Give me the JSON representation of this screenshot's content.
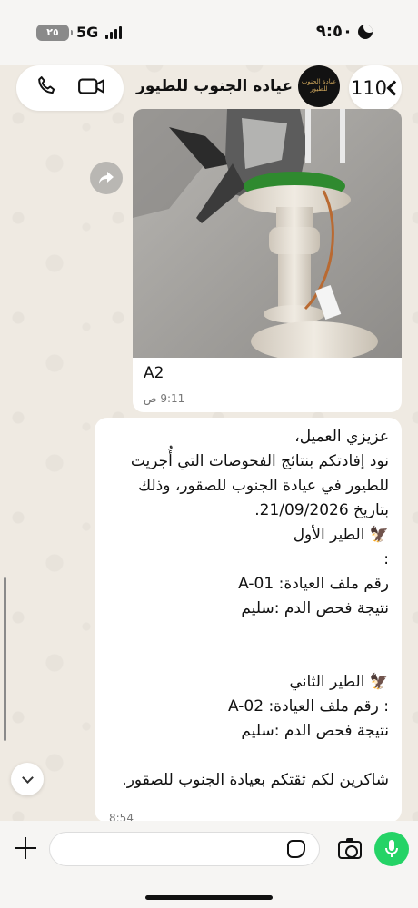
{
  "status_bar": {
    "time": "٩:٥٠",
    "battery": "٢٥",
    "network": "5G"
  },
  "header": {
    "back_count": "110",
    "chat_title": "عياده الجنوب للطيور",
    "avatar_text": "عيادة الجنوب للطيور"
  },
  "image_message": {
    "caption": "A2",
    "time": "9:11 ص"
  },
  "text_message": {
    "body": "عزيزي العميل،\nنود إفادتكم بنتائج الفحوصات التي أُجريت للطيور في عيادة الجنوب للصقور، وذلك بتاريخ 21/09/2026.\n🦅 الطير الأول\n:\nرقم ملف العيادة: A-01\nنتيجة فحص الدم :سليم\n\n\n🦅 الطير الثاني\n: رقم ملف العيادة: A-02\nنتيجة فحص الدم :سليم\n\nشاكرين لكم ثقتكم بعيادة الجنوب للصقور.",
    "time": "8:54"
  },
  "composer": {
    "placeholder": ""
  },
  "colors": {
    "accent": "#25d366",
    "bubble": "#ffffff",
    "wallpaper": "#efeae2"
  },
  "icons": [
    "moon-icon",
    "signal-icon",
    "phone-icon",
    "video-icon",
    "chevron-left-icon",
    "forward-icon",
    "chevron-down-icon",
    "plus-icon",
    "sticker-icon",
    "camera-icon",
    "mic-icon"
  ]
}
